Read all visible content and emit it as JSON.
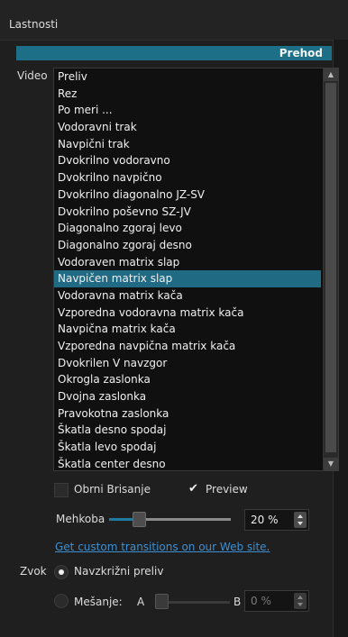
{
  "panel": {
    "title": "Lastnosti"
  },
  "section": {
    "title": "Prehod"
  },
  "video": {
    "label": "Video",
    "items": [
      "Preliv",
      "Rez",
      "Po meri ...",
      "Vodoravni trak",
      "Navpični trak",
      "Dvokrilno vodoravno",
      "Dvokrilno navpično",
      "Dvokrilno diagonalno JZ-SV",
      "Dvokrilno poševno SZ-JV",
      "Diagonalno zgoraj levo",
      "Diagonalno zgoraj desno",
      "Vodoraven matrix slap",
      "Navpičen matrix slap",
      "Vodoravna matrix kača",
      "Vzporedna vodoravna matrix kača",
      "Navpična matrix kača",
      "Vzporedna navpična matrix kača",
      "Dvokrilen V navzgor",
      "Okrogla zaslonka",
      "Dvojna zaslonka",
      "Pravokotna zaslonka",
      "Škatla desno spodaj",
      "Škatla levo spodaj",
      "Škatla center desno"
    ],
    "selected_item": "Navpičen matrix slap"
  },
  "options": {
    "invert_label": "Obrni Brisanje",
    "invert_checked": false,
    "preview_label": "Preview",
    "preview_checked": true
  },
  "softness": {
    "label": "Mehkoba",
    "value": "20 %",
    "fraction": 0.2
  },
  "link": {
    "text": "Get custom transitions on our Web site."
  },
  "audio": {
    "label": "Zvok",
    "crossfade_label": "Navzkrižni preliv",
    "crossfade_selected": true,
    "mix_label": "Mešanje:",
    "mix_a": "A",
    "mix_b": "B",
    "mix_value": "0 %",
    "mix_fraction": 0.0
  },
  "colors": {
    "accent": "#1d6f87",
    "selection": "#216a83",
    "link": "#3d8fd1",
    "slider_fill": "#1f7aa0"
  }
}
